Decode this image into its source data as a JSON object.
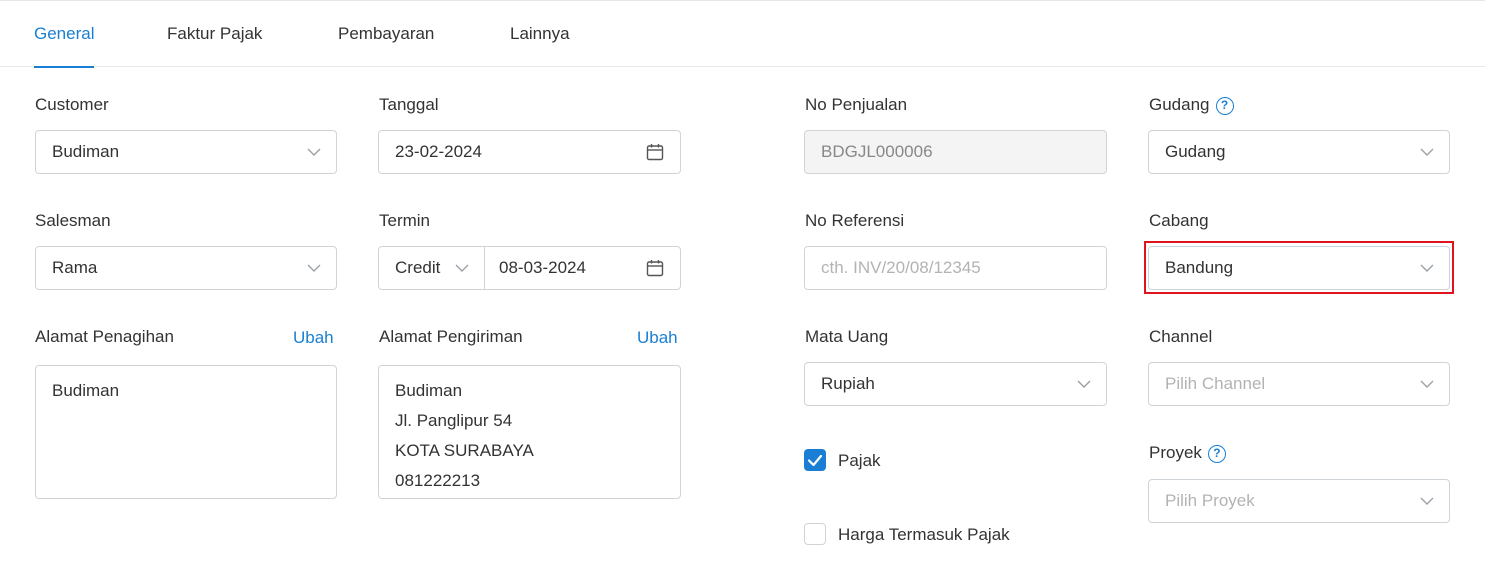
{
  "tabs": [
    {
      "label": "General",
      "active": true
    },
    {
      "label": "Faktur Pajak"
    },
    {
      "label": "Pembayaran"
    },
    {
      "label": "Lainnya"
    }
  ],
  "form": {
    "customer": {
      "label": "Customer",
      "value": "Budiman"
    },
    "tanggal": {
      "label": "Tanggal",
      "value": "23-02-2024"
    },
    "no_penjualan": {
      "label": "No Penjualan",
      "value": "BDGJL000006"
    },
    "gudang": {
      "label": "Gudang",
      "value": "Gudang",
      "help": "?"
    },
    "salesman": {
      "label": "Salesman",
      "value": "Rama"
    },
    "termin": {
      "label": "Termin",
      "type_value": "Credit",
      "date_value": "08-03-2024"
    },
    "no_referensi": {
      "label": "No Referensi",
      "placeholder": "cth. INV/20/08/12345"
    },
    "cabang": {
      "label": "Cabang",
      "value": "Bandung"
    },
    "alamat_penagihan": {
      "label": "Alamat Penagihan",
      "action": "Ubah",
      "lines": [
        "Budiman"
      ]
    },
    "alamat_pengiriman": {
      "label": "Alamat Pengiriman",
      "action": "Ubah",
      "lines": [
        "Budiman",
        "Jl. Panglipur 54",
        "KOTA SURABAYA",
        "081222213"
      ]
    },
    "mata_uang": {
      "label": "Mata Uang",
      "value": "Rupiah"
    },
    "channel": {
      "label": "Channel",
      "placeholder": "Pilih Channel"
    },
    "pajak": {
      "label": "Pajak",
      "checked": true
    },
    "harga_termasuk_pajak": {
      "label": "Harga Termasuk Pajak",
      "checked": false
    },
    "proyek": {
      "label": "Proyek",
      "placeholder": "Pilih Proyek",
      "help": "?"
    }
  },
  "colors": {
    "accent": "#1a7fd4",
    "highlight": "#e0141e"
  }
}
